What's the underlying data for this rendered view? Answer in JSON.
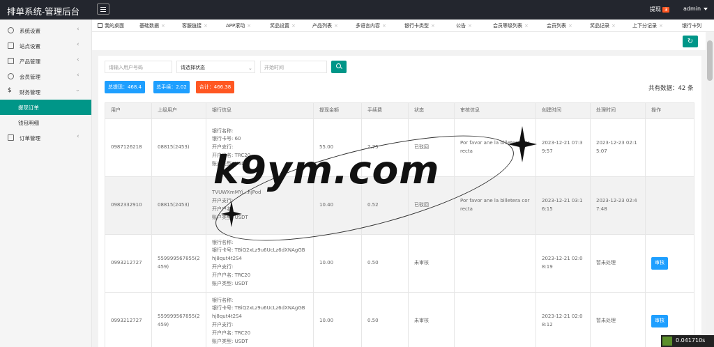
{
  "header": {
    "title": "排单系统-管理后台",
    "notification_label": "提现",
    "notification_count": "3",
    "user": "admin"
  },
  "sidebar": {
    "items": [
      {
        "label": "系统设置"
      },
      {
        "label": "站点设置"
      },
      {
        "label": "产品管理"
      },
      {
        "label": "会员管理"
      },
      {
        "label": "财务管理"
      },
      {
        "label": "提现订单"
      },
      {
        "label": "钱包明细"
      },
      {
        "label": "订单管理"
      }
    ]
  },
  "tabs": [
    {
      "label": "我的桌面"
    },
    {
      "label": "基础数据"
    },
    {
      "label": "客服链接"
    },
    {
      "label": "APP滚动"
    },
    {
      "label": "奖品设置"
    },
    {
      "label": "产品列表"
    },
    {
      "label": "多语言内容"
    },
    {
      "label": "银行卡类型"
    },
    {
      "label": "公告"
    },
    {
      "label": "会员等级列表"
    },
    {
      "label": "会员列表"
    },
    {
      "label": "奖品记录"
    },
    {
      "label": "上下分记录"
    },
    {
      "label": "银行卡列"
    }
  ],
  "filters": {
    "user_placeholder": "请输入用户号码",
    "status_placeholder": "请选择状态",
    "time_placeholder": "开始时间"
  },
  "stats": {
    "total_withdraw": "总提现：468.4",
    "total_fee": "总手续：2.02",
    "total_sum": "合计：466.38",
    "total_count": "共有数据：42 条"
  },
  "table": {
    "headers": [
      "用户",
      "上级用户",
      "银行信息",
      "提现金额",
      "手续费",
      "状态",
      "审核信息",
      "创建时间",
      "处理时间",
      "操作"
    ],
    "rows": [
      {
        "user": "0987126218",
        "parent": "08815(2453)",
        "bank": [
          "银行名称:",
          "银行卡号: 60",
          "开户支行:",
          "开户户名: TRC20",
          "账户类型: USDT"
        ],
        "amount": "55.00",
        "fee": "2.75",
        "status": "已驳回",
        "audit": "Por favor ane la billetera correcta",
        "created": "2023-12-21 07:39:57",
        "processed": "2023-12-23 02:15:07",
        "action": ""
      },
      {
        "user": "0982332910",
        "parent": "08815(2453)",
        "bank": [
          "",
          "TVUWXmMYi...hjPod",
          "开户支行:",
          "开户户名:",
          "账户类型: USDT"
        ],
        "amount": "10.40",
        "fee": "0.52",
        "status": "已驳回",
        "audit": "Por favor ane la billetera correcta",
        "created": "2023-12-21 03:16:15",
        "processed": "2023-12-23 02:47:48",
        "action": ""
      },
      {
        "user": "0993212727",
        "parent": "559999567855(2459)",
        "bank": [
          "银行名称:",
          "银行卡号: TBiQ2xLz9u6UcLz6dXNAgGBhj8qut4t2S4",
          "开户支行:",
          "开户户名: TRC20",
          "账户类型: USDT"
        ],
        "amount": "10.00",
        "fee": "0.50",
        "status": "未审核",
        "audit": "",
        "created": "2023-12-21 02:08:19",
        "processed": "暂未处理",
        "action": "审核"
      },
      {
        "user": "0993212727",
        "parent": "559999567855(2459)",
        "bank": [
          "银行名称:",
          "银行卡号: TBiQ2xLz9u6UcLz6dXNAgGBhj8qut4t2S4",
          "开户支行:",
          "开户户名: TRC20",
          "账户类型: USDT"
        ],
        "amount": "10.00",
        "fee": "0.50",
        "status": "未审核",
        "audit": "",
        "created": "2023-12-21 02:08:12",
        "processed": "暂未处理",
        "action": "审核"
      }
    ]
  },
  "watermark": {
    "text": "k9ym.com"
  },
  "timer": {
    "value": "0.041710s"
  },
  "colors": {
    "primary": "#009688",
    "header": "#23262e",
    "badge_blue": "#1e9fff",
    "badge_orange": "#ff5722",
    "audit_button": "#1e9fff"
  }
}
